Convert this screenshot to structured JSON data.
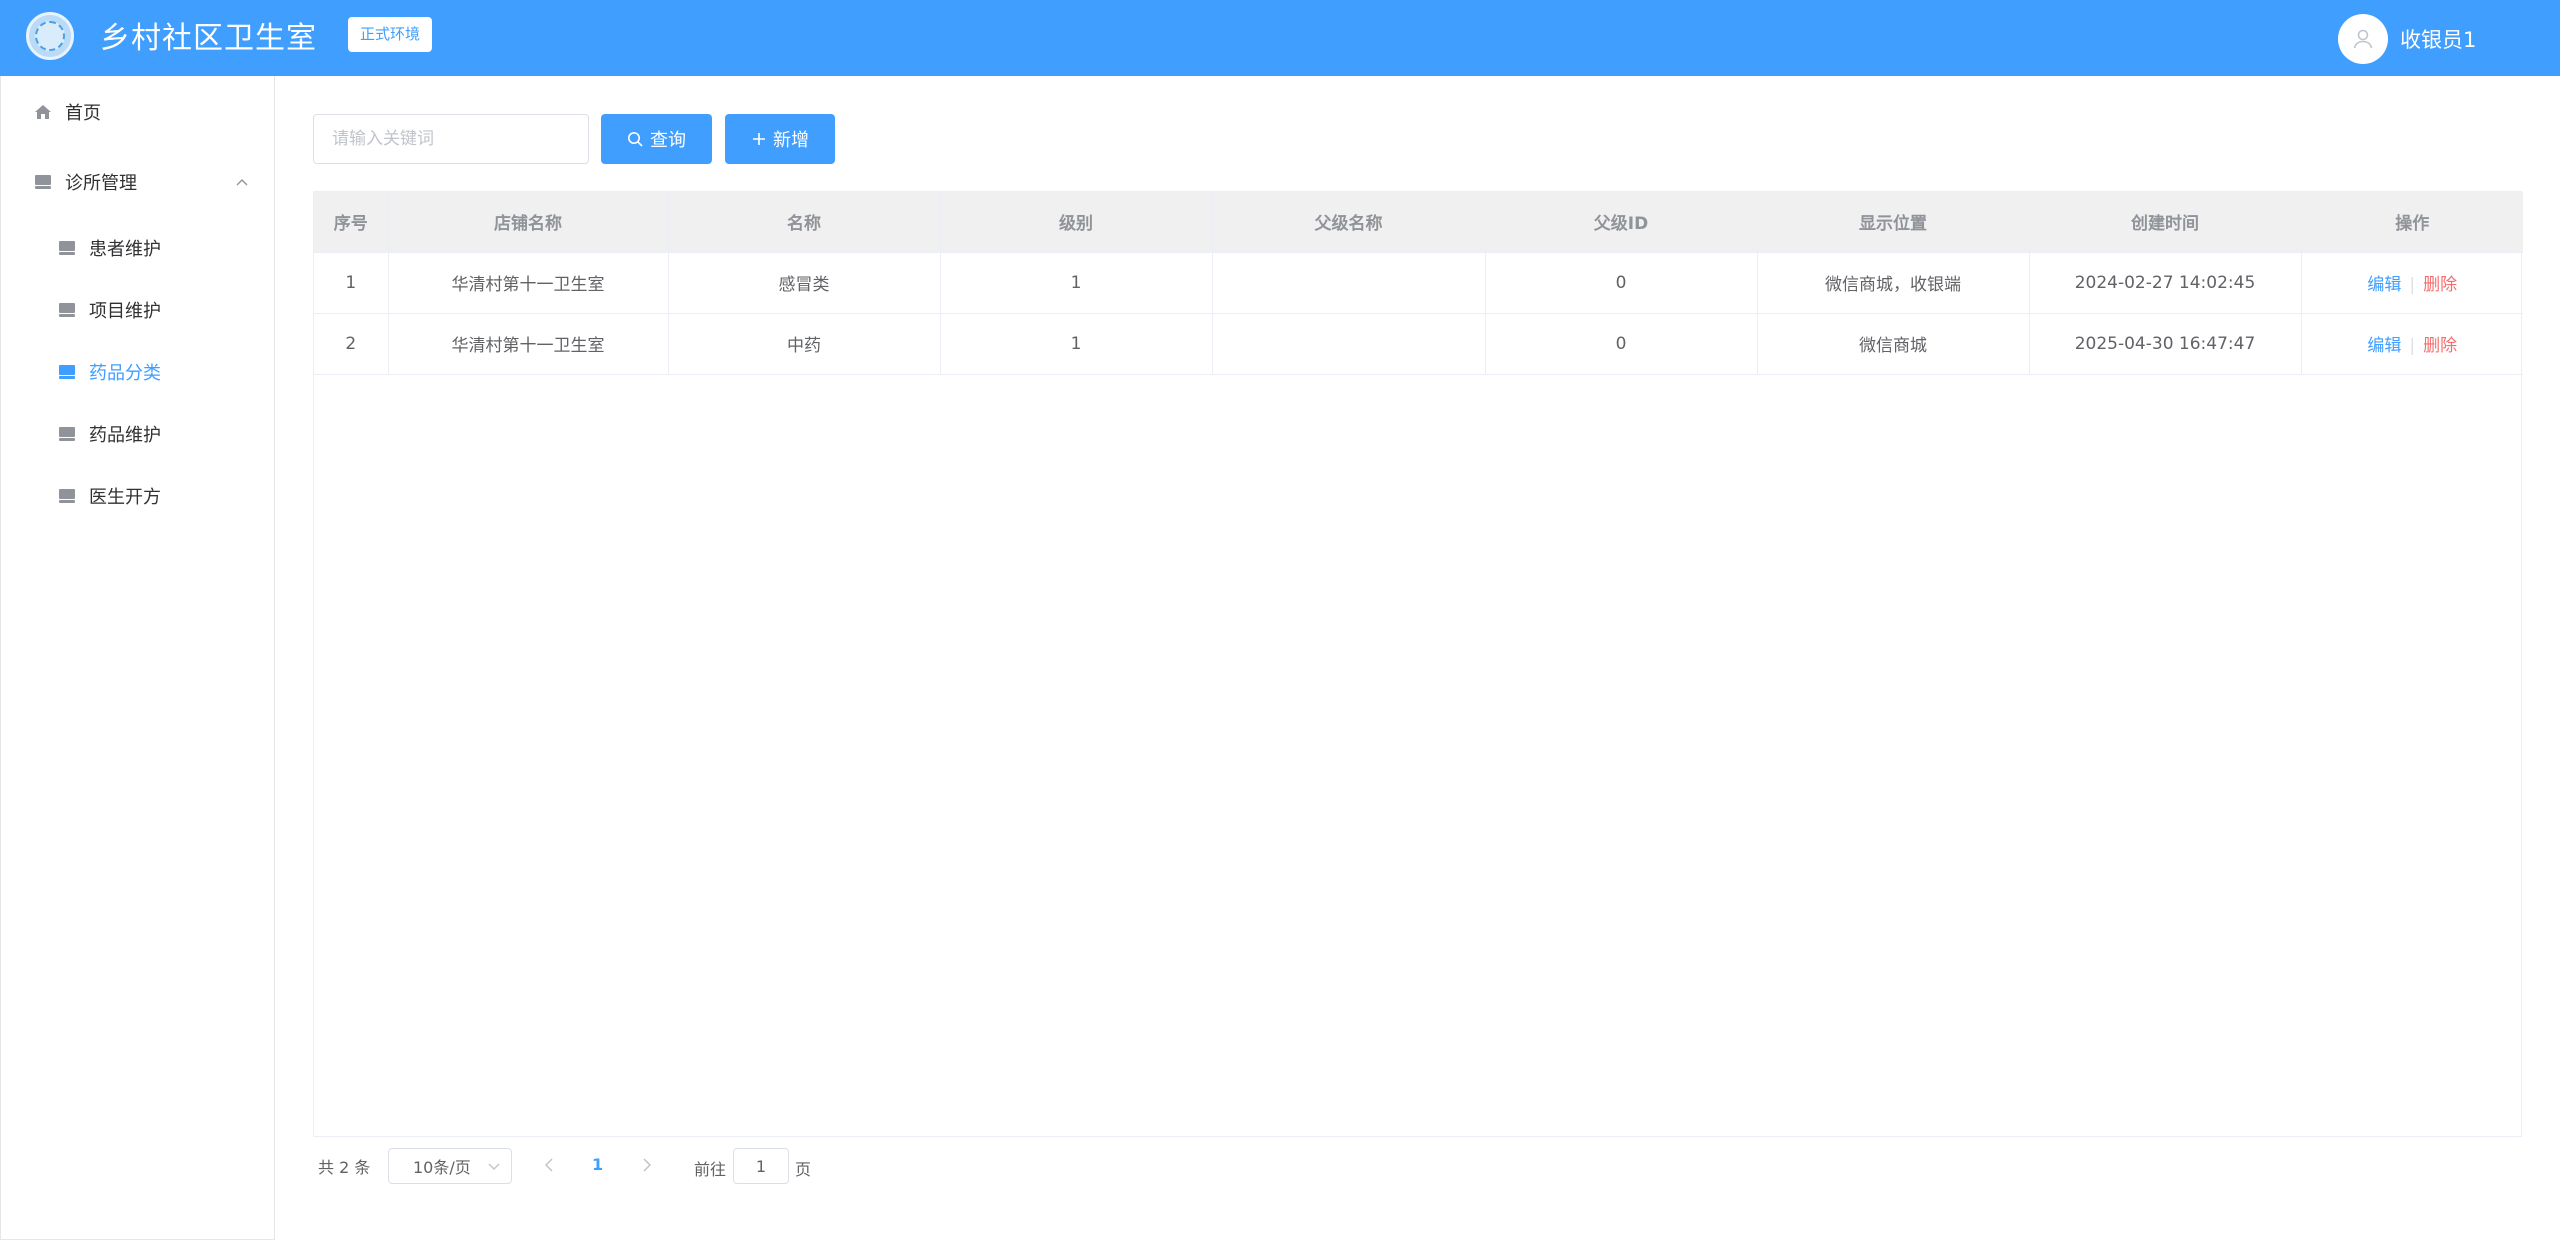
{
  "header": {
    "title": "乡村社区卫生室",
    "env_badge": "正式环境",
    "user_name": "收银员1",
    "brand_color": "#409eff"
  },
  "sidebar": {
    "items": [
      {
        "label": "首页",
        "icon": "home-icon"
      },
      {
        "label": "诊所管理",
        "icon": "folder-icon",
        "expanded": true
      },
      {
        "label": "患者维护",
        "icon": "folder-icon"
      },
      {
        "label": "项目维护",
        "icon": "folder-icon"
      },
      {
        "label": "药品分类",
        "icon": "folder-icon",
        "active": true
      },
      {
        "label": "药品维护",
        "icon": "folder-icon"
      },
      {
        "label": "医生开方",
        "icon": "folder-icon"
      }
    ]
  },
  "toolbar": {
    "search_placeholder": "请输入关键词",
    "search_value": "",
    "query_label": "查询",
    "add_label": "新增"
  },
  "table": {
    "columns": [
      "序号",
      "店铺名称",
      "名称",
      "级别",
      "父级名称",
      "父级ID",
      "显示位置",
      "创建时间",
      "操作"
    ],
    "rows": [
      {
        "seq": "1",
        "shop": "华清村第十一卫生室",
        "name": "感冒类",
        "level": "1",
        "parent_name": "",
        "parent_id": "0",
        "position": "微信商城，收银端",
        "created": "2024-02-27 14:02:45",
        "edit": "编辑",
        "delete": "删除"
      },
      {
        "seq": "2",
        "shop": "华清村第十一卫生室",
        "name": "中药",
        "level": "1",
        "parent_name": "",
        "parent_id": "0",
        "position": "微信商城",
        "created": "2025-04-30 16:47:47",
        "edit": "编辑",
        "delete": "删除"
      }
    ]
  },
  "pagination": {
    "total_text": "共 2 条",
    "page_size": "10条/页",
    "current_page": "1",
    "goto_prefix": "前往",
    "goto_value": "1",
    "goto_suffix": "页"
  }
}
